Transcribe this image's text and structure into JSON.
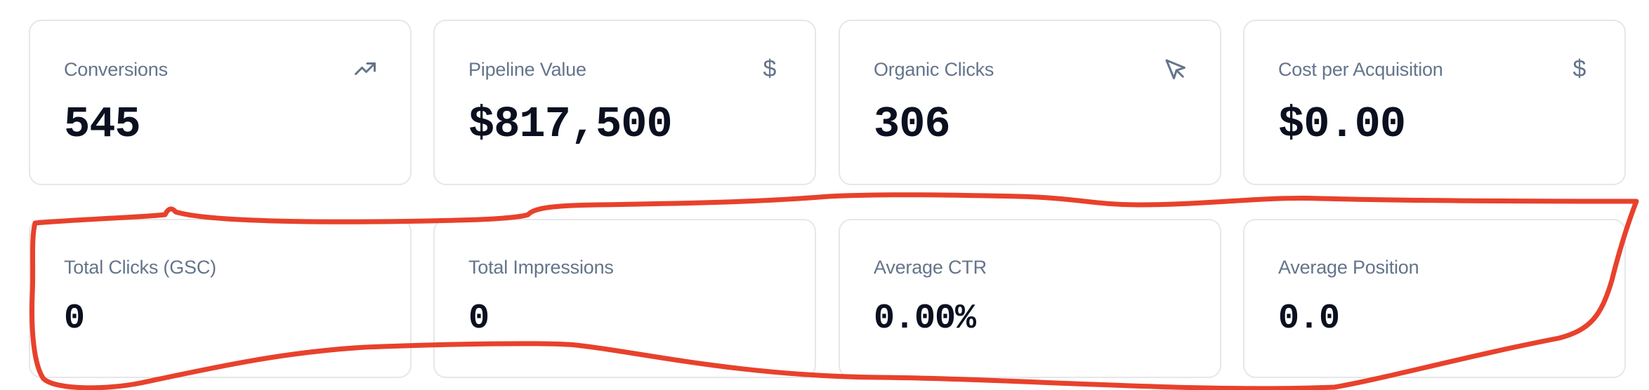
{
  "metrics_top": [
    {
      "label": "Conversions",
      "value": "545",
      "icon": "trending-up-icon"
    },
    {
      "label": "Pipeline Value",
      "value": "$817,500",
      "icon": "dollar-icon",
      "icon_glyph": "$"
    },
    {
      "label": "Organic Clicks",
      "value": "306",
      "icon": "cursor-pointer-icon"
    },
    {
      "label": "Cost per Acquisition",
      "value": "$0.00",
      "icon": "dollar-icon",
      "icon_glyph": "$"
    }
  ],
  "metrics_gsc": [
    {
      "label": "Total Clicks (GSC)",
      "value": "0"
    },
    {
      "label": "Total Impressions",
      "value": "0"
    },
    {
      "label": "Average CTR",
      "value": "0.00%"
    },
    {
      "label": "Average Position",
      "value": "0.0"
    }
  ],
  "colors": {
    "annotation": "#e8412c",
    "label": "#64748b",
    "value": "#0b1020",
    "border": "#e5e7eb"
  }
}
